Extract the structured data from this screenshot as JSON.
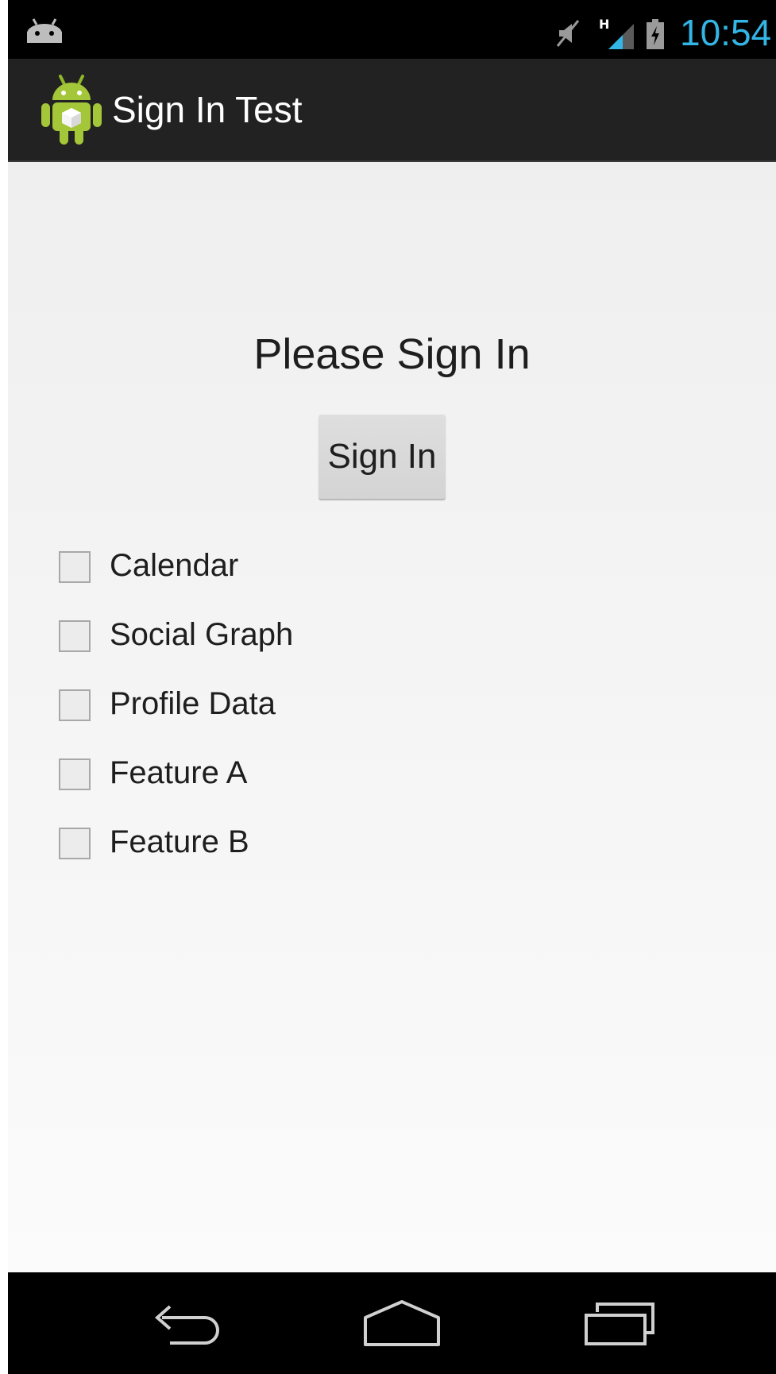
{
  "status_bar": {
    "time": "10:54",
    "network_type": "H",
    "icons": [
      "notification-android-icon",
      "mute-icon",
      "signal-icon",
      "battery-charging-icon"
    ]
  },
  "action_bar": {
    "title": "Sign In Test",
    "icon": "android-app-icon"
  },
  "main": {
    "prompt": "Please Sign In",
    "sign_in_label": "Sign In",
    "options": [
      {
        "label": "Calendar",
        "checked": false
      },
      {
        "label": "Social Graph",
        "checked": false
      },
      {
        "label": "Profile Data",
        "checked": false
      },
      {
        "label": "Feature A",
        "checked": false
      },
      {
        "label": "Feature B",
        "checked": false
      }
    ]
  },
  "nav_bar": {
    "buttons": [
      "back-icon",
      "home-icon",
      "recent-apps-icon"
    ]
  },
  "colors": {
    "clock": "#33b5e5",
    "action_bar": "#222222",
    "content_bg": "#f3f3f3",
    "android_green": "#a4c639"
  }
}
